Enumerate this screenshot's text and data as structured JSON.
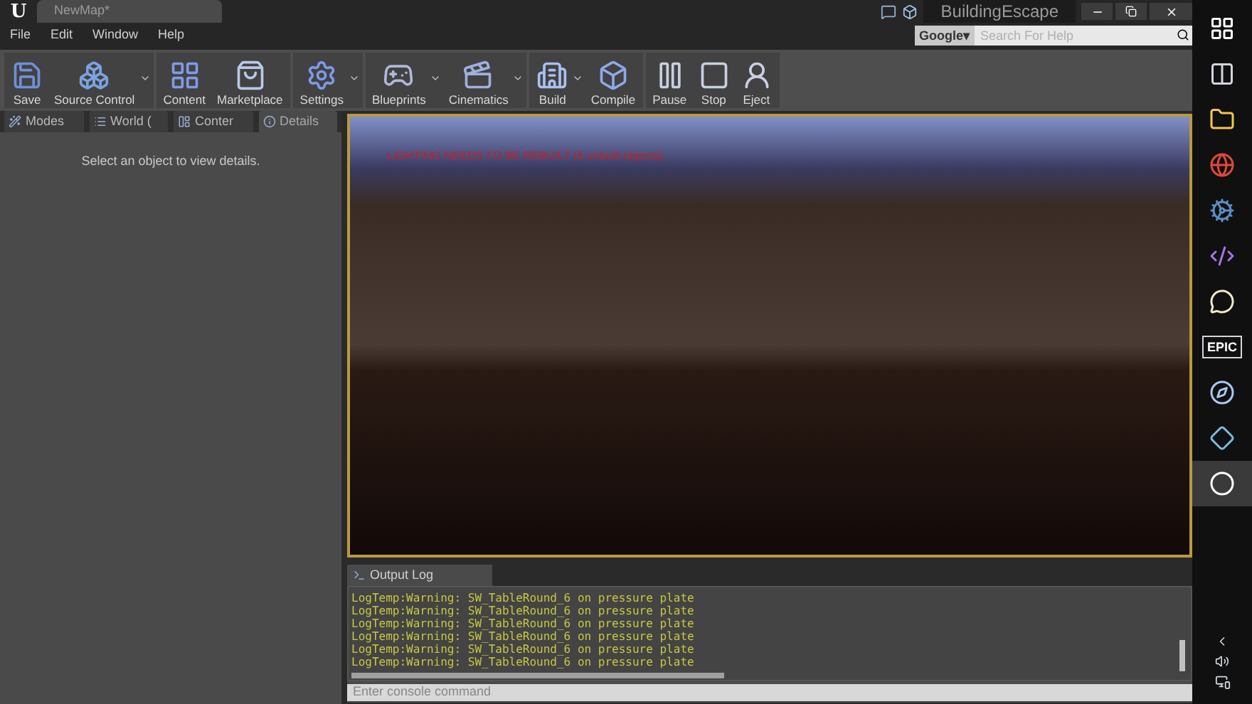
{
  "window": {
    "logo": "U",
    "doc_tab": "NewMap*",
    "project": "BuildingEscape"
  },
  "search": {
    "engine": "Google▾",
    "placeholder": "Search For Help"
  },
  "menu": [
    "File",
    "Edit",
    "Window",
    "Help"
  ],
  "toolbar": [
    {
      "label": "Save",
      "dropdown": false
    },
    {
      "label": "Source Control",
      "dropdown": true
    },
    {
      "label": "Content",
      "dropdown": false
    },
    {
      "label": "Marketplace",
      "dropdown": false
    },
    {
      "label": "Settings",
      "dropdown": true
    },
    {
      "label": "Blueprints",
      "dropdown": true
    },
    {
      "label": "Cinematics",
      "dropdown": true
    },
    {
      "label": "Build",
      "dropdown": true
    },
    {
      "label": "Compile",
      "dropdown": false
    },
    {
      "label": "Pause",
      "dropdown": false
    },
    {
      "label": "Stop",
      "dropdown": false
    },
    {
      "label": "Eject",
      "dropdown": false
    }
  ],
  "panel_tabs": [
    {
      "label": "Modes",
      "selected": false
    },
    {
      "label": "World (",
      "selected": false
    },
    {
      "label": "Conter",
      "selected": false
    },
    {
      "label": "Details",
      "selected": true
    }
  ],
  "details_message": "Select an object to view details.",
  "viewport": {
    "warning": "LIGHTING NEEDS TO BE REBUILT (5 unbuilt objects)"
  },
  "output_log": {
    "tab": "Output Log",
    "lines": [
      "LogTemp:Warning: SW_TableRound_6 on pressure plate",
      "LogTemp:Warning: SW_TableRound_6 on pressure plate",
      "LogTemp:Warning: SW_TableRound_6 on pressure plate",
      "LogTemp:Warning: SW_TableRound_6 on pressure plate",
      "LogTemp:Warning: SW_TableRound_6 on pressure plate",
      "LogTemp:Warning: SW_TableRound_6 on pressure plate"
    ],
    "console_placeholder": "Enter console command"
  },
  "taskbar": [
    {
      "kind": "start"
    },
    {
      "kind": "taskview"
    },
    {
      "kind": "folder"
    },
    {
      "kind": "browser"
    },
    {
      "kind": "steam"
    },
    {
      "kind": "studio"
    },
    {
      "kind": "chat"
    },
    {
      "kind": "epic",
      "label": "EPIC"
    },
    {
      "kind": "wheel"
    },
    {
      "kind": "tile"
    },
    {
      "kind": "unreal",
      "selected": true
    }
  ]
}
